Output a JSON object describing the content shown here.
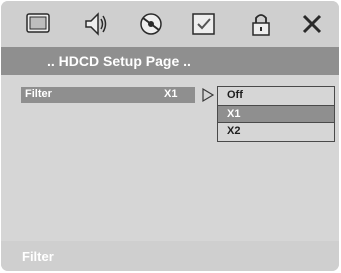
{
  "toolbar": {
    "icons": [
      "tv-icon",
      "speaker-icon",
      "disc-icon",
      "checkbox-icon",
      "lock-icon",
      "close-icon"
    ]
  },
  "title": ".. HDCD Setup Page ..",
  "setting": {
    "label": "Filter",
    "value": "X1"
  },
  "dropdown": {
    "options": [
      "Off",
      "X1",
      "X2"
    ],
    "selected": "X1"
  },
  "footer": {
    "text": "Filter"
  },
  "colors": {
    "panel": "#d6d6d6",
    "highlight": "#8f8f8f",
    "text_light": "#ffffff",
    "text_dark": "#1e1e1e"
  }
}
